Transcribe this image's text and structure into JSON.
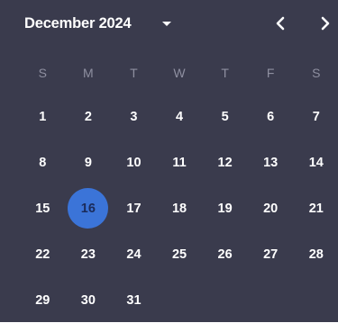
{
  "header": {
    "month_year": "December 2024"
  },
  "icons": {
    "dropdown": "caret-down-icon",
    "prev": "chevron-left-icon",
    "next": "chevron-right-icon"
  },
  "colors": {
    "background": "#3a3b4d",
    "selected": "#3b74d8",
    "weekday_text": "#8e8fa0",
    "day_text": "#ffffff"
  },
  "weekdays": [
    "S",
    "M",
    "T",
    "W",
    "T",
    "F",
    "S"
  ],
  "selected_day": "16",
  "weeks": [
    [
      "1",
      "2",
      "3",
      "4",
      "5",
      "6",
      "7"
    ],
    [
      "8",
      "9",
      "10",
      "11",
      "12",
      "13",
      "14"
    ],
    [
      "15",
      "16",
      "17",
      "18",
      "19",
      "20",
      "21"
    ],
    [
      "22",
      "23",
      "24",
      "25",
      "26",
      "27",
      "28"
    ],
    [
      "29",
      "30",
      "31",
      "",
      "",
      "",
      ""
    ]
  ]
}
